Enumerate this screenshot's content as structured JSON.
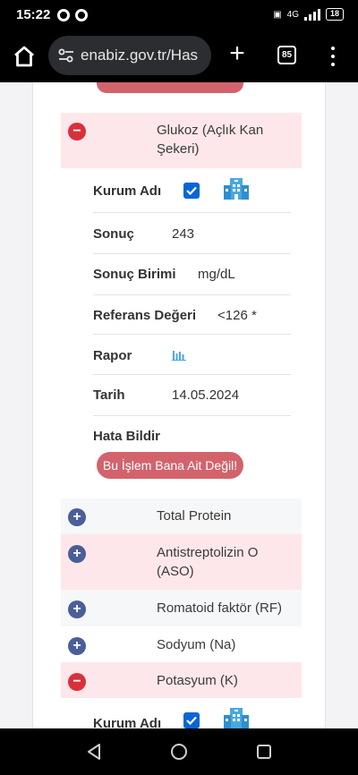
{
  "status": {
    "time": "15:22",
    "battery": "18",
    "network": "4G"
  },
  "browser": {
    "url": "enabiz.gov.tr/Has",
    "tab_count": "85"
  },
  "tests": [
    {
      "name": "Glukoz (Açlık Kan Şekeri)",
      "expanded": true
    },
    {
      "name": "Total Protein",
      "expanded": false
    },
    {
      "name": "Antistreptolizin O (ASO)",
      "expanded": false
    },
    {
      "name": "Romatoid faktör (RF)",
      "expanded": false
    },
    {
      "name": "Sodyum (Na)",
      "expanded": false
    },
    {
      "name": "Potasyum (K)",
      "expanded": true
    }
  ],
  "glukoz_details": {
    "kurum_label": "Kurum Adı",
    "sonuc_label": "Sonuç",
    "sonuc_value": "243",
    "birim_label": "Sonuç Birimi",
    "birim_value": "mg/dL",
    "referans_label": "Referans Değeri",
    "referans_value": "<126 *",
    "rapor_label": "Rapor",
    "tarih_label": "Tarih",
    "tarih_value": "14.05.2024",
    "hata_label": "Hata Bildir",
    "hata_button": "Bu İşlem Bana Ait Değil!"
  },
  "potasyum_details": {
    "kurum_label": "Kurum Adı"
  },
  "colors": {
    "accent_red": "#d2636c",
    "minus_red": "#d9303a",
    "plus_blue": "#4a5e98",
    "pink_row": "#fde7ea",
    "checkbox_blue": "#0a66d6"
  }
}
